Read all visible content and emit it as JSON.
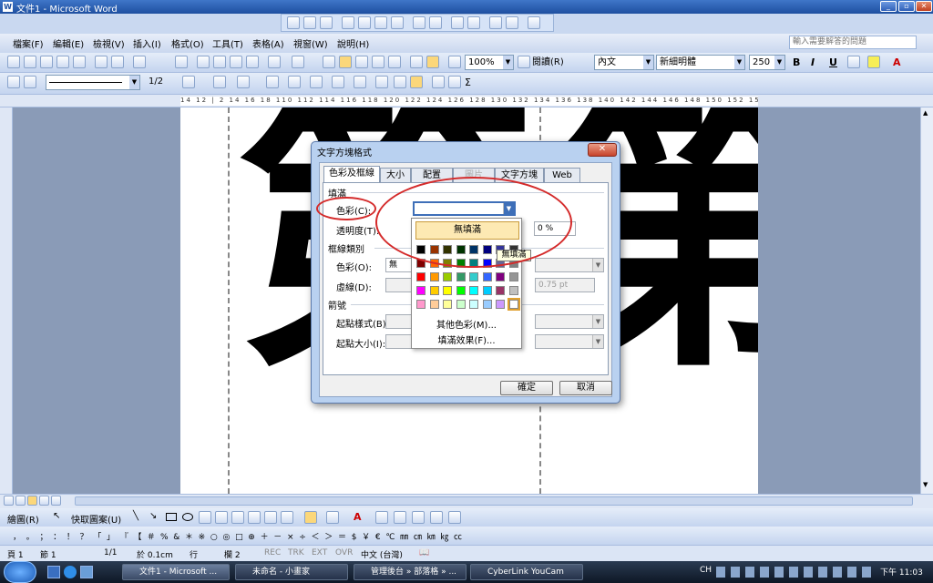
{
  "window": {
    "title": "文件1 - Microsoft Word"
  },
  "menu": [
    "檔案(F)",
    "編輯(E)",
    "檢視(V)",
    "插入(I)",
    "格式(O)",
    "工具(T)",
    "表格(A)",
    "視窗(W)",
    "說明(H)"
  ],
  "help_placeholder": "輸入需要解答的問題",
  "toolbar": {
    "zoom": "100%",
    "read_label": "閱讀(R)",
    "style": "內文",
    "font": "新細明體",
    "size": "250",
    "bold": "B",
    "italic": "I",
    "underline": "U",
    "line_weight": "1/2"
  },
  "ruler_text": "14  12  |  2  14  16  18  110  112  114  116  118  120  122  124  126  128  130  132  134  136  138  140  142  144  146  148  150  152  154  156",
  "document": {
    "glyphs": [
      "第",
      "第"
    ]
  },
  "dialog": {
    "title": "文字方塊格式",
    "close": "✕",
    "tabs": [
      "色彩及框線",
      "大小",
      "配置",
      "圖片",
      "文字方塊",
      "Web"
    ],
    "fill_section": "填滿",
    "color_label": "色彩(C):",
    "transparency_label": "透明度(T):",
    "transparency_value": "0 %",
    "line_section": "框線類別",
    "line_color_label": "色彩(O):",
    "line_color_value": "無",
    "dash_label": "虛線(D):",
    "weight_value": "0.75 pt",
    "arrows_section": "箭號",
    "begin_style_label": "起點樣式(B):",
    "begin_size_label": "起點大小(I):",
    "ok": "確定",
    "cancel": "取消"
  },
  "palette": {
    "no_fill": "無填滿",
    "tooltip": "無填滿",
    "more_colors": "其他色彩(M)...",
    "fill_effects": "填滿效果(F)...",
    "colors": [
      "#000000",
      "#993300",
      "#333300",
      "#003300",
      "#003366",
      "#000080",
      "#333399",
      "#333333",
      "#800000",
      "#ff6600",
      "#808000",
      "#008000",
      "#008080",
      "#0000ff",
      "#666699",
      "#808080",
      "#ff0000",
      "#ff9900",
      "#99cc00",
      "#339966",
      "#33cccc",
      "#3366ff",
      "#800080",
      "#969696",
      "#ff00ff",
      "#ffcc00",
      "#ffff00",
      "#00ff00",
      "#00ffff",
      "#00ccff",
      "#993366",
      "#c0c0c0",
      "#ff99cc",
      "#ffcc99",
      "#ffff99",
      "#ccffcc",
      "#ccffff",
      "#99ccff",
      "#cc99ff",
      "#ffffff"
    ]
  },
  "drawing_toolbar": {
    "draw": "繪圖(R)",
    "autoshapes": "快取圖案(U)"
  },
  "symbols": "，  。  ；  ：  ！  ？  「  」  『  【  ＃  %  &  ＊  ※  ○  ◎  □  ⊕  ＋  －  ×  ÷  ＜  ＞  ＝  $  ￥  €  ℃  ㎜  ㎝  ㎞  ㎏  ㏄",
  "status": {
    "page": "頁 1",
    "section": "節 1",
    "pages": "1/1",
    "at": "於 0.1cm",
    "line": "行",
    "col": "欄 2",
    "rec": "REC",
    "trk": "TRK",
    "ext": "EXT",
    "ovr": "OVR",
    "lang": "中文 (台灣)"
  },
  "taskbar": {
    "tasks": [
      "文件1 - Microsoft ...",
      "未命名 - 小畫家",
      "管理後台 » 部落格 » ...",
      "CyberLink YouCam"
    ],
    "lang": "CH",
    "clock": "下午 11:03"
  }
}
